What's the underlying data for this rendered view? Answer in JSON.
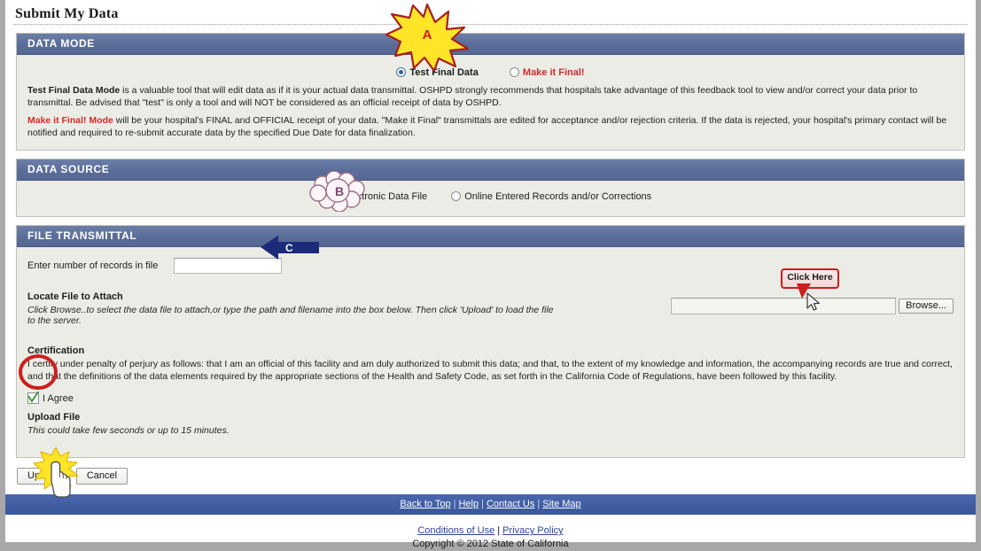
{
  "page": {
    "title": "Submit My Data"
  },
  "data_mode": {
    "header": "DATA MODE",
    "options": [
      {
        "label": "Test Final Data",
        "selected": true
      },
      {
        "label": "Make it Final!",
        "selected": false
      }
    ],
    "paragraph1_bold": "Test Final Data Mode",
    "paragraph1_rest": " is a valuable tool that will edit data as if it is your actual data transmittal. OSHPD strongly recommends that hospitals take advantage of this feedback tool to view and/or correct your data prior to transmittal. Be advised that \"test\" is only a tool and will NOT be considered as an official receipt of data by OSHPD.",
    "paragraph2_bold": "Make it Final! Mode",
    "paragraph2_rest": " will be your hospital's FINAL and OFFICIAL receipt of your data. \"Make it Final\" transmittals are edited for acceptance and/or rejection criteria. If the data is rejected, your hospital's primary contact will be notified and required to re-submit accurate data by the specified Due Date for data finalization."
  },
  "data_source": {
    "header": "DATA SOURCE",
    "options": [
      {
        "label": "Electronic Data File",
        "selected": true
      },
      {
        "label": "Online Entered Records and/or Corrections",
        "selected": false
      }
    ]
  },
  "file_transmittal": {
    "header": "FILE TRANSMITTAL",
    "records_label": "Enter number of records in file",
    "records_value": "",
    "locate_title": "Locate File to Attach",
    "locate_note": "Click Browse..to select the data file to attach,or type the path and filename into the box below. Then click 'Upload' to load the file to the server.",
    "file_path_value": "",
    "browse_label": "Browse...",
    "certification_title": "Certification",
    "certification_text": "I certify under penalty of perjury as follows: that I am an official of this facility and am duly authorized to submit this data; and that, to the extent of my knowledge and information, the accompanying records are true and correct, and that the definitions of the data elements required by the appropriate sections of the Health and Safety Code, as set forth in the California Code of Regulations, have been followed by this facility.",
    "agree_label": "I Agree",
    "agree_checked": true,
    "upload_title": "Upload File",
    "upload_note": "This could take few seconds or up to 15 minutes."
  },
  "actions": {
    "upload_label": "Upload",
    "cancel_label": "Cancel"
  },
  "footer": {
    "nav": [
      {
        "label": "Back to Top"
      },
      {
        "label": "Help"
      },
      {
        "label": "Contact Us"
      },
      {
        "label": "Site Map"
      }
    ],
    "separator": "|",
    "conditions_label": "Conditions of Use",
    "privacy_label": "Privacy Policy",
    "copyright": "Copyright © 2012 State of California"
  },
  "annotations": {
    "starburst_a": "A",
    "cloud_b": "B",
    "arrow_c": "C",
    "click_here": "Click Here"
  },
  "colors": {
    "panel_header": "#5a6d99",
    "footer_nav": "#3f5ca2",
    "accent_red": "#d32b2b",
    "annotation_navy": "#1b2a7a",
    "annotation_yellow": "#ffe528",
    "annotation_purple": "#7a4a6e",
    "check_green": "#3f9a3f"
  }
}
